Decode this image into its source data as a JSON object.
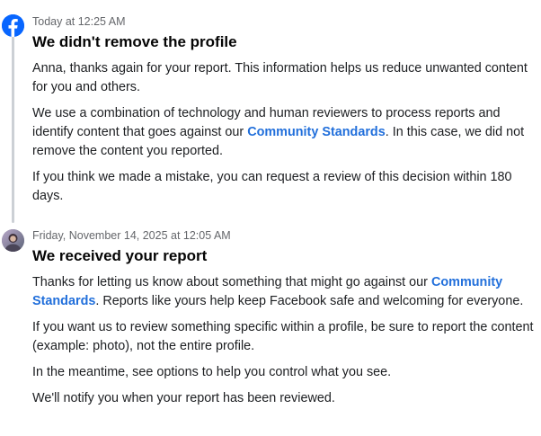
{
  "colors": {
    "link": "#216fdb",
    "timestamp": "#65676b",
    "facebook_blue": "#0866ff",
    "timeline_line": "#ccd0d5"
  },
  "entries": [
    {
      "icon": "facebook-logo-icon",
      "timestamp": "Today at 12:25 AM",
      "title": "We didn't remove the profile",
      "p1": "Anna, thanks again for your report. This information helps us reduce unwanted content for you and others.",
      "p2_before": "We use a combination of technology and human reviewers to process reports and identify content that goes against our ",
      "p2_link": "Community Standards",
      "p2_after": ". In this case, we did not remove the content you reported.",
      "p3": "If you think we made a mistake, you can request a review of this decision within 180 days."
    },
    {
      "icon": "user-avatar",
      "timestamp": "Friday, November 14, 2025 at 12:05 AM",
      "title": "We received your report",
      "p1_before": "Thanks for letting us know about something that might go against our ",
      "p1_link": "Community Standards",
      "p1_after": ". Reports like yours help keep Facebook safe and welcoming for everyone.",
      "p2": "If you want us to review something specific within a profile, be sure to report the content (example: photo), not the entire profile.",
      "p3": "In the meantime, see options to help you control what you see.",
      "p4": "We'll notify you when your report has been reviewed."
    }
  ]
}
